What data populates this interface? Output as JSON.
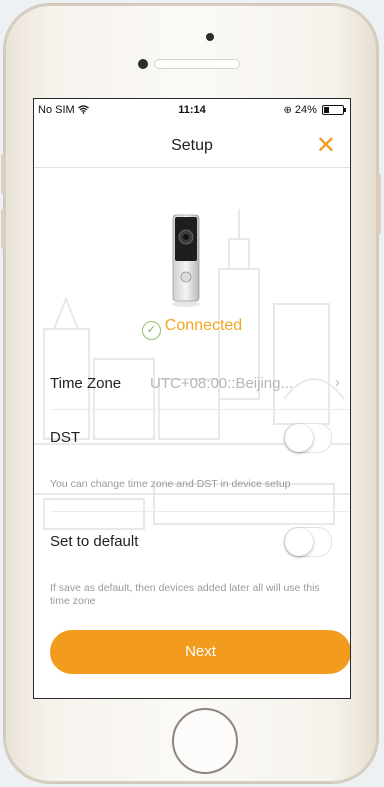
{
  "status_bar": {
    "carrier": "No SIM",
    "time": "11:14",
    "battery": "24%"
  },
  "nav": {
    "title": "Setup",
    "close_glyph": "✕"
  },
  "device": {
    "image_icon": "doorbell-camera-icon"
  },
  "connection": {
    "status": "Connected"
  },
  "settings": {
    "time_zone": {
      "label": "Time Zone",
      "value": "UTC+08:00::Beijing...",
      "chevron": "›"
    },
    "dst": {
      "label": "DST",
      "enabled": false,
      "hint": "You can change time zone and DST in device setup"
    },
    "default": {
      "label": "Set to default",
      "enabled": false,
      "hint": "If save as default, then devices added later all will use this time zone"
    }
  },
  "actions": {
    "next_label": "Next"
  },
  "colors": {
    "accent": "#f29b1d",
    "connected_text": "#f3a421",
    "success_check": "#7bb24f"
  }
}
